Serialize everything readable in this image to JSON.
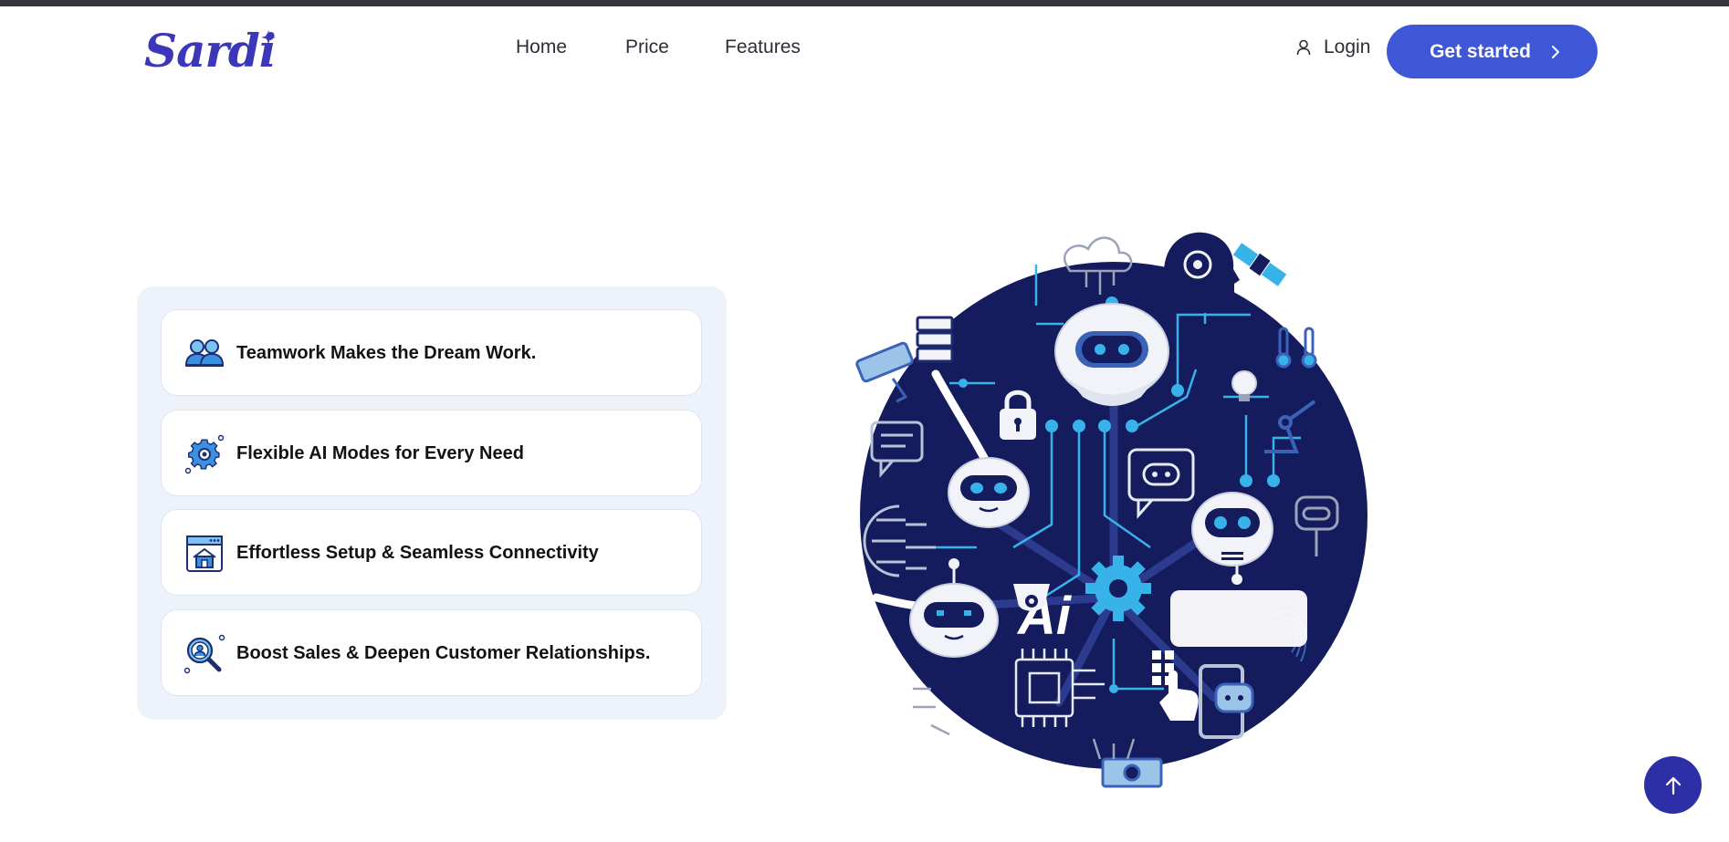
{
  "header": {
    "logo": "Sardi",
    "nav": [
      {
        "label": "Home"
      },
      {
        "label": "Price"
      },
      {
        "label": "Features"
      }
    ],
    "login_label": "Login",
    "cta_label": "Get started"
  },
  "features": [
    {
      "label": "Teamwork Makes the Dream Work.",
      "icon": "team-icon"
    },
    {
      "label": "Flexible AI Modes for Every Need",
      "icon": "gear-icon"
    },
    {
      "label": "Effortless Setup & Seamless Connectivity",
      "icon": "browser-home-icon"
    },
    {
      "label": "Boost Sales & Deepen Customer Relationships.",
      "icon": "magnifier-user-icon"
    }
  ],
  "illustration": {
    "text": "Ai",
    "icon": "ai-robots-network-illustration"
  },
  "colors": {
    "brand": "#3b37b8",
    "cta": "#3d57d6",
    "panel_bg": "#eef3fb",
    "illustration_navy": "#141c5e",
    "accent_cyan": "#38b3ea",
    "scroll_top": "#2d2fa6"
  }
}
